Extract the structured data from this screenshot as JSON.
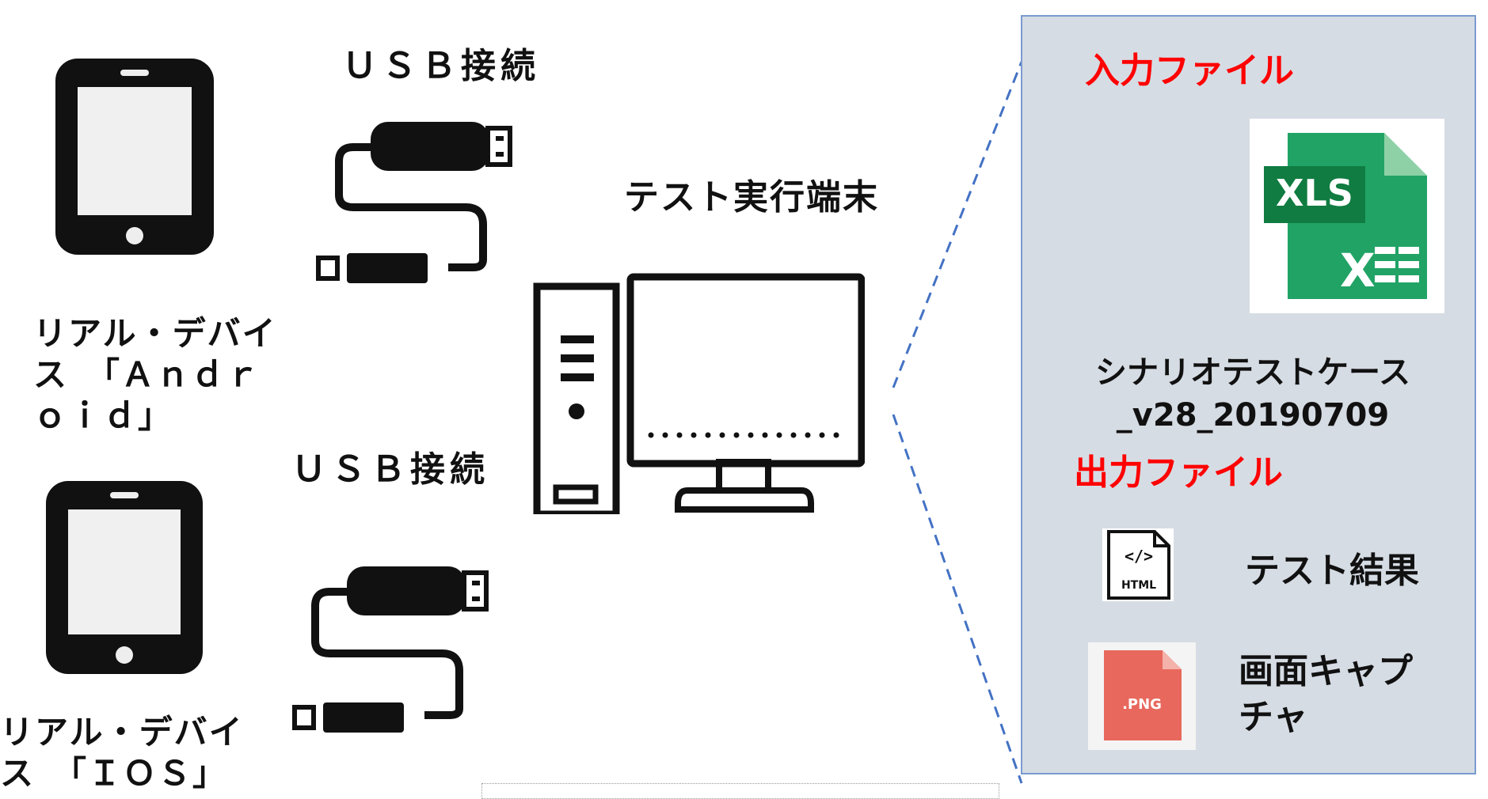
{
  "devices": [
    {
      "label": "リアル・デバイ\nス　「Ａｎｄｒ\nｏｉｄ」"
    },
    {
      "label": "リアル・デバイ\nス　「ＩＯＳ」"
    }
  ],
  "usb": [
    {
      "label": "ＵＳＢ接続"
    },
    {
      "label": "ＵＳＢ接続"
    }
  ],
  "terminal": {
    "label": "テスト実行端末"
  },
  "panel": {
    "input_heading": "入力ファイル",
    "xls_badge": "XLS",
    "input_file_name": "シナリオテストケース\n_v28_20190709",
    "output_heading": "出力ファイル",
    "html_badge": "HTML",
    "html_code": "</>",
    "html_output_label": "テスト結果",
    "png_badge": ".PNG",
    "png_output_label": "画面キャプ\nチャ"
  },
  "colors": {
    "accent_red": "#ff0000",
    "panel_bg": "#d6dce4",
    "panel_border": "#7b9bd0",
    "connector_blue": "#4472c4",
    "excel_green": "#21a366",
    "png_red": "#e8685d"
  }
}
